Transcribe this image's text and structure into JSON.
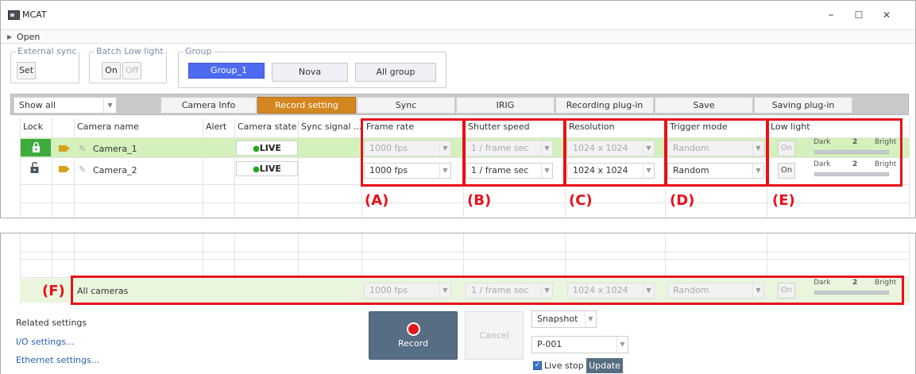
{
  "window": {
    "title": "MCAT",
    "min": "–",
    "max": "☐",
    "close": "✕"
  },
  "open_label": "Open",
  "external_sync": {
    "legend": "External sync",
    "button": "Set"
  },
  "batch_low_light": {
    "legend": "Batch Low light",
    "on": "On",
    "off": "Off"
  },
  "group": {
    "legend": "Group",
    "buttons": [
      "Group_1",
      "Nova",
      "All group"
    ],
    "selected": "Group_1"
  },
  "filter": {
    "value": "Show all"
  },
  "tabs": [
    "Camera Info",
    "Record setting",
    "Sync",
    "IRIG",
    "Recording plug-in",
    "Save",
    "Saving plug-in"
  ],
  "active_tab": "Record setting",
  "columns": [
    "Lock",
    "Camera name",
    "Alert",
    "Camera state",
    "Sync signal ...",
    "Frame rate",
    "Shutter speed",
    "Resolution",
    "Trigger mode",
    "Low light"
  ],
  "cameras": [
    {
      "name": "Camera_1",
      "state": "LIVE",
      "frame_rate": "1000 fps",
      "shutter": "1 / frame sec",
      "resolution": "1024 x 1024",
      "trigger": "Random",
      "low_light": "On",
      "dark": "Dark",
      "level": "2",
      "bright": "Bright",
      "locked": true
    },
    {
      "name": "Camera_2",
      "state": "LIVE",
      "frame_rate": "1000 fps",
      "shutter": "1 / frame sec",
      "resolution": "1024 x 1024",
      "trigger": "Random",
      "low_light": "On",
      "dark": "Dark",
      "level": "2",
      "bright": "Bright",
      "locked": false
    }
  ],
  "all_cameras": {
    "name": "All cameras",
    "frame_rate": "1000 fps",
    "shutter": "1 / frame sec",
    "resolution": "1024 x 1024",
    "trigger": "Random",
    "low_light": "On",
    "dark": "Dark",
    "level": "2",
    "bright": "Bright"
  },
  "annotations": [
    "(A)",
    "(B)",
    "(C)",
    "(D)",
    "(E)",
    "(F)"
  ],
  "related": {
    "title": "Related settings",
    "links": [
      "I/O settings...",
      "Ethernet settings..."
    ]
  },
  "record": {
    "label": "Record",
    "cancel": "Cancel"
  },
  "snapshot": {
    "label": "Snapshot",
    "value": "P-001",
    "live_stop": "Live stop",
    "live_stop_checked": true,
    "update": "Update"
  },
  "colors": {
    "accent_tab": "#d4861f",
    "group_selected": "#4d6bf0",
    "live_dot": "#1ea81e",
    "annotation": "#e8101a",
    "row_selected": "#d4f0bc"
  }
}
